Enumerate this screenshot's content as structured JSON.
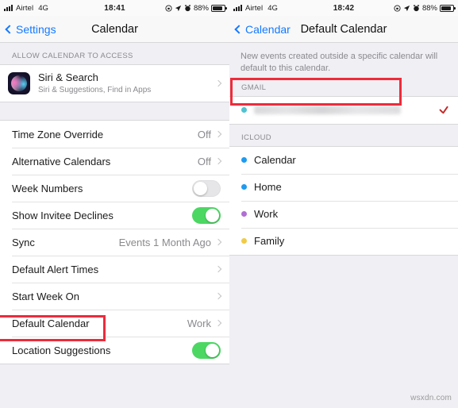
{
  "left_screen": {
    "status_bar": {
      "signal_icon": "signal-bars-icon",
      "carrier": "Airtel",
      "network": "4G",
      "time": "18:41",
      "orientation_lock_icon": "rotation-lock-icon",
      "location_icon": "location-arrow-icon",
      "alarm_icon": "alarm-clock-icon",
      "battery_percent": "88%",
      "battery_icon": "battery-icon"
    },
    "nav": {
      "back_label": "Settings",
      "back_icon": "chevron-left-icon",
      "title": "Calendar"
    },
    "section_header": "ALLOW CALENDAR TO ACCESS",
    "siri_row": {
      "icon": "siri-app-icon",
      "title": "Siri & Search",
      "subtitle": "Siri & Suggestions, Find in Apps",
      "chevron": "chevron-right-icon"
    },
    "settings_rows": [
      {
        "label": "Time Zone Override",
        "value": "Off",
        "accessory": "chevron"
      },
      {
        "label": "Alternative Calendars",
        "value": "Off",
        "accessory": "chevron"
      },
      {
        "label": "Week Numbers",
        "value": "",
        "accessory": "toggle-off"
      },
      {
        "label": "Show Invitee Declines",
        "value": "",
        "accessory": "toggle-on"
      }
    ],
    "settings_rows_2": [
      {
        "label": "Sync",
        "value": "Events 1 Month Ago",
        "accessory": "chevron"
      },
      {
        "label": "Default Alert Times",
        "value": "",
        "accessory": "chevron"
      },
      {
        "label": "Start Week On",
        "value": "",
        "accessory": "chevron"
      },
      {
        "label": "Default Calendar",
        "value": "Work",
        "accessory": "chevron"
      },
      {
        "label": "Location Suggestions",
        "value": "",
        "accessory": "toggle-on"
      }
    ]
  },
  "right_screen": {
    "status_bar": {
      "signal_icon": "signal-bars-icon",
      "carrier": "Airtel",
      "network": "4G",
      "time": "18:42",
      "orientation_lock_icon": "rotation-lock-icon",
      "location_icon": "location-arrow-icon",
      "alarm_icon": "alarm-clock-icon",
      "battery_percent": "88%",
      "battery_icon": "battery-icon"
    },
    "nav": {
      "back_label": "Calendar",
      "back_icon": "chevron-left-icon",
      "title": "Default Calendar"
    },
    "description": "New events created outside a specific calendar will default to this calendar.",
    "gmail_header": "GMAIL",
    "gmail_account": {
      "label": "",
      "redacted": true,
      "dot_color": "#4fc3d0",
      "selected": true,
      "checkmark_color": "#c32a2a"
    },
    "icloud_header": "ICLOUD",
    "icloud_calendars": [
      {
        "label": "Calendar",
        "dot_color": "#1d9bf0",
        "selected": false
      },
      {
        "label": "Home",
        "dot_color": "#1d9bf0",
        "selected": false
      },
      {
        "label": "Work",
        "dot_color": "#b06ed4",
        "selected": false
      },
      {
        "label": "Family",
        "dot_color": "#f0cb46",
        "selected": false
      }
    ]
  },
  "annotations": {
    "highlight_color": "#ee2b3a",
    "highlighted_left": "Default Calendar",
    "highlighted_right": "gmail-account-row"
  },
  "watermark": "wsxdn.com",
  "colors": {
    "accent_blue": "#1479ff",
    "toggle_green": "#4cd763",
    "group_bg": "#efeff4",
    "row_bg": "#ffffff",
    "secondary_text": "#8a8a8f"
  }
}
